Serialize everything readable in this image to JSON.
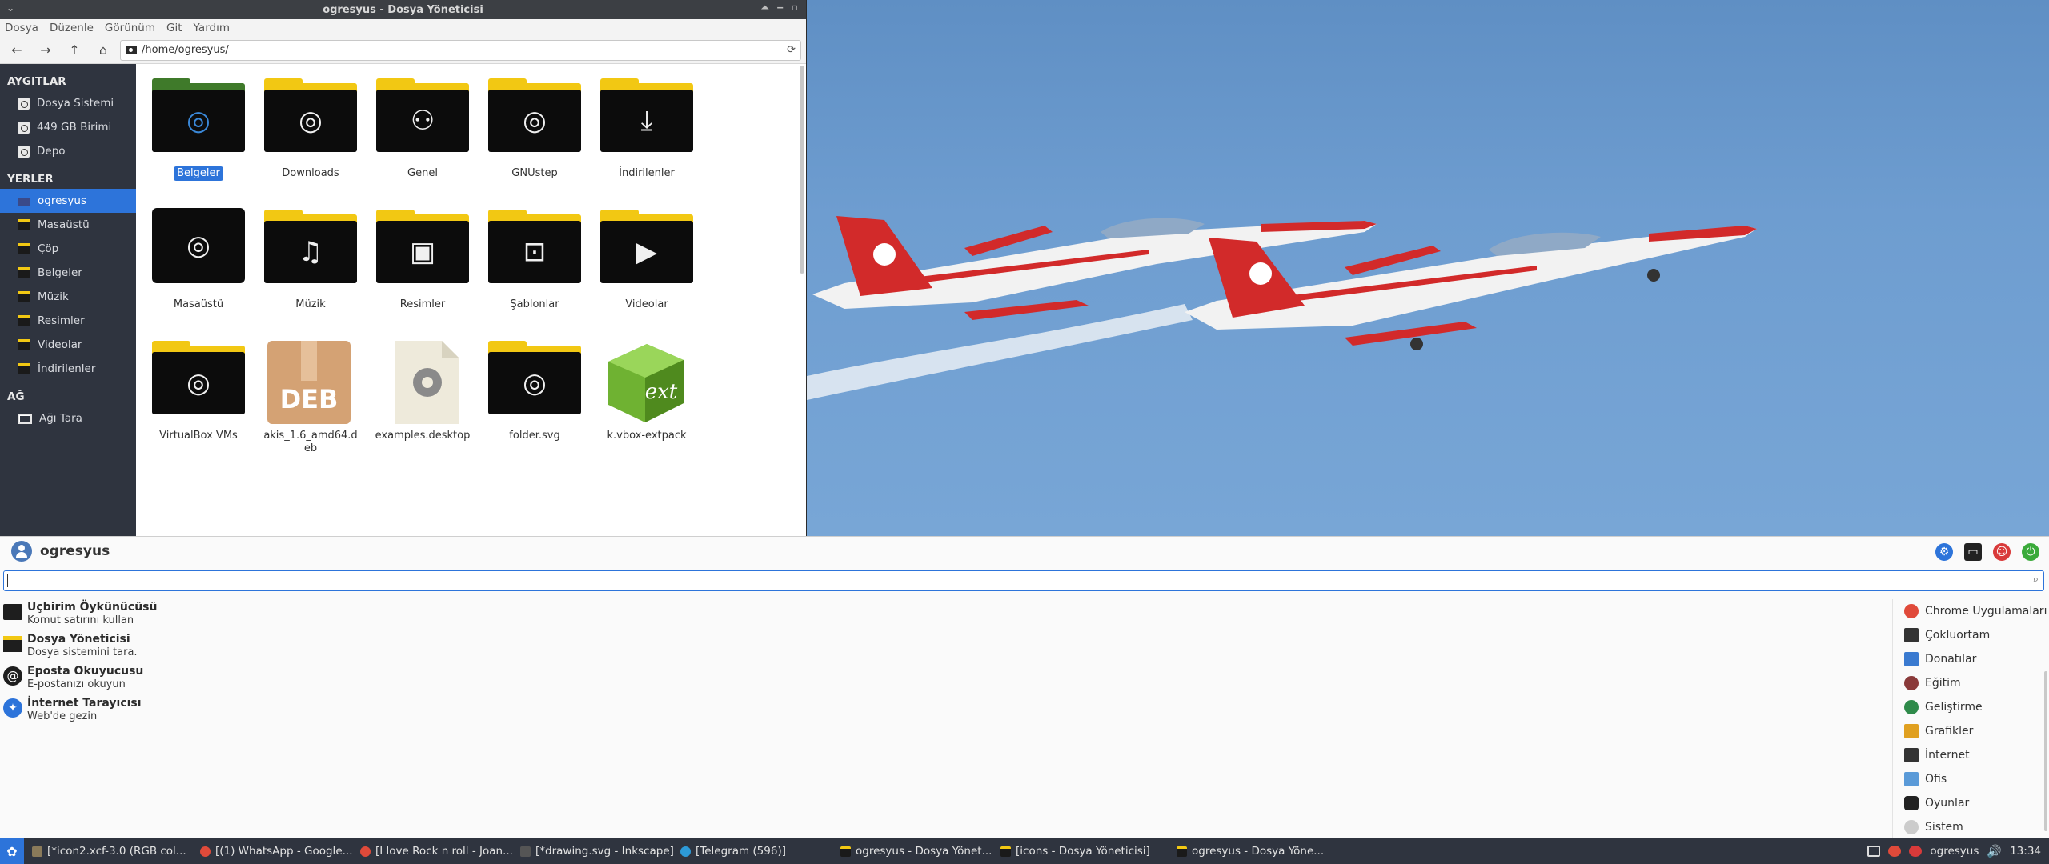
{
  "colors": {
    "accent": "#2d74da",
    "sidebar_bg": "#2f343f",
    "folder_yellow": "#f2c813",
    "folder_green": "#3f7a2a"
  },
  "window": {
    "title": "ogresyus - Dosya Yöneticisi",
    "menu": [
      "Dosya",
      "Düzenle",
      "Görünüm",
      "Git",
      "Yardım"
    ],
    "address": "/home/ogresyus/"
  },
  "sidebar": {
    "devices_head": "AYGITLAR",
    "devices": [
      "Dosya Sistemi",
      "449 GB Birimi",
      "Depo"
    ],
    "places_head": "YERLER",
    "places": [
      "ogresyus",
      "Masaüstü",
      "Çöp",
      "Belgeler",
      "Müzik",
      "Resimler",
      "Videolar",
      "İndirilenler"
    ],
    "network_head": "AĞ",
    "network": [
      "Ağı Tara"
    ]
  },
  "files": [
    {
      "name": "Belgeler",
      "icon": "folder-documents"
    },
    {
      "name": "Downloads",
      "icon": "folder-downloads"
    },
    {
      "name": "Genel",
      "icon": "folder-public"
    },
    {
      "name": "GNUstep",
      "icon": "folder-gnustep"
    },
    {
      "name": "İndirilenler",
      "icon": "folder-download-arrow"
    },
    {
      "name": "Masaüstü",
      "icon": "folder-desktop"
    },
    {
      "name": "Müzik",
      "icon": "folder-music"
    },
    {
      "name": "Resimler",
      "icon": "folder-pictures"
    },
    {
      "name": "Şablonlar",
      "icon": "folder-templates"
    },
    {
      "name": "Videolar",
      "icon": "folder-videos"
    },
    {
      "name": "VirtualBox VMs",
      "icon": "folder-vbox"
    },
    {
      "name": "akis_1.6_amd64.deb",
      "icon": "deb-package"
    },
    {
      "name": "examples.desktop",
      "icon": "desktop-file-gear"
    },
    {
      "name": "folder.svg",
      "icon": "folder-svg"
    },
    {
      "name": "k.vbox-extpack",
      "icon": "ext-package"
    }
  ],
  "menu": {
    "user": "ogresyus",
    "search_placeholder": "",
    "favorites": [
      {
        "title": "Uçbirim Öykünücüsü",
        "desc": "Komut satırını kullan",
        "icon": "terminal-icon"
      },
      {
        "title": "Dosya Yöneticisi",
        "desc": "Dosya sistemini tara.",
        "icon": "file-manager-icon"
      },
      {
        "title": "Eposta Okuyucusu",
        "desc": "E-postanızı okuyun",
        "icon": "mail-icon"
      },
      {
        "title": "İnternet Tarayıcısı",
        "desc": "Web'de gezin",
        "icon": "browser-icon"
      }
    ],
    "categories": [
      {
        "label": "Chrome Uygulamaları",
        "color": "#e04a3a"
      },
      {
        "label": "Çokluortam",
        "color": "#333333"
      },
      {
        "label": "Donatılar",
        "color": "#3a7ad0"
      },
      {
        "label": "Eğitim",
        "color": "#8a3a3a"
      },
      {
        "label": "Geliştirme",
        "color": "#2e8a4a"
      },
      {
        "label": "Grafikler",
        "color": "#e0a020"
      },
      {
        "label": "İnternet",
        "color": "#333333"
      },
      {
        "label": "Ofis",
        "color": "#5a9ad8"
      },
      {
        "label": "Oyunlar",
        "color": "#222222"
      },
      {
        "label": "Sistem",
        "color": "#cccccc"
      }
    ]
  },
  "taskbar": {
    "tasks": [
      {
        "label": "[*icon2.xcf-3.0 (RGB col...",
        "color": "#8a7a5a"
      },
      {
        "label": "[(1) WhatsApp - Google...",
        "color": "#e04a3a"
      },
      {
        "label": "[I love Rock n roll - Joan...",
        "color": "#e04a3a"
      },
      {
        "label": "[*drawing.svg - Inkscape]",
        "color": "#444444"
      },
      {
        "label": "[Telegram (596)]",
        "color": "#2d9ad8"
      },
      {
        "label": "ogresyus - Dosya Yönet...",
        "color": "#f2c813"
      },
      {
        "label": "[icons - Dosya Yöneticisi]",
        "color": "#f2c813"
      },
      {
        "label": "ogresyus - Dosya Yöne...",
        "color": "#f2c813"
      }
    ],
    "user": "ogresyus",
    "clock": "13:34"
  }
}
